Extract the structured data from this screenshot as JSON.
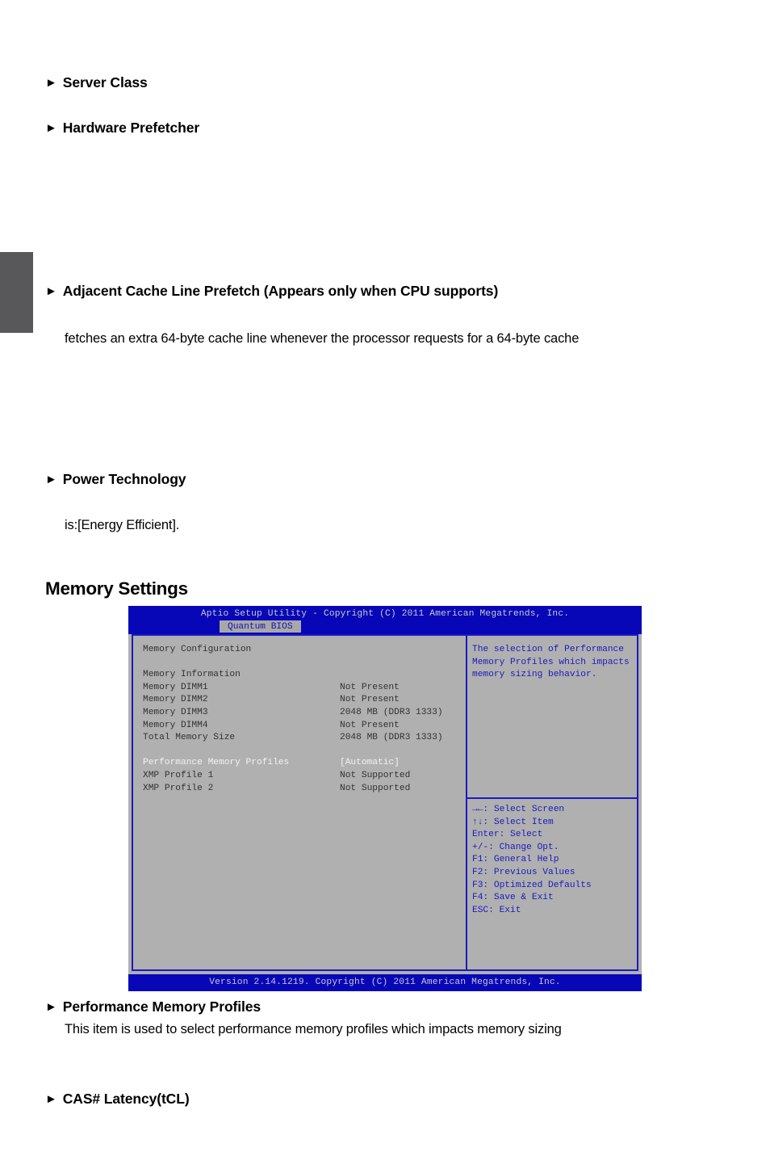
{
  "page": {
    "edge_tab": "section-tab-marker"
  },
  "doc": {
    "items": [
      {
        "name": "server-class",
        "marker": "►",
        "label": "Server Class"
      },
      {
        "name": "hardware-prefetcher",
        "marker": "►",
        "label": "Hardware Prefetcher"
      },
      {
        "name": "adjacent-cache-line-prefetch",
        "marker": "►",
        "label": "Adjacent Cache Line Prefetch (Appears only when CPU supports)"
      },
      {
        "name": "power-technology",
        "marker": "►",
        "label": "Power Technology"
      },
      {
        "name": "performance-memory-profiles",
        "marker": "►",
        "label": "Performance Memory Profiles"
      },
      {
        "name": "cas-latency-tcl",
        "marker": "►",
        "label": "CAS# Latency(tCL)"
      }
    ],
    "body": {
      "adjacent_cache_desc": "fetches an extra 64-byte cache line whenever the processor requests for a 64-byte cache",
      "power_technology_desc": "is:[Energy Efficient].",
      "performance_memory_profiles_desc": "This item is used to select performance memory profiles which impacts memory sizing"
    },
    "section_title": "Memory Settings"
  },
  "bios": {
    "title": "Aptio Setup Utility - Copyright (C) 2011 American Megatrends, Inc.",
    "tab": "Quantum BIOS",
    "footer": "Version 2.14.1219. Copyright (C) 2011 American Megatrends, Inc.",
    "left_rows": [
      {
        "label": "Memory Configuration",
        "value": "",
        "selected": false
      },
      {
        "label": "",
        "value": "",
        "selected": false
      },
      {
        "label": "Memory Information",
        "value": "",
        "selected": false
      },
      {
        "label": "Memory DIMM1",
        "value": "Not Present",
        "selected": false
      },
      {
        "label": "Memory DIMM2",
        "value": "Not Present",
        "selected": false
      },
      {
        "label": "Memory DIMM3",
        "value": "2048 MB (DDR3 1333)",
        "selected": false
      },
      {
        "label": "Memory DIMM4",
        "value": "Not Present",
        "selected": false
      },
      {
        "label": "Total Memory Size",
        "value": "2048 MB (DDR3 1333)",
        "selected": false
      },
      {
        "label": "",
        "value": "",
        "selected": false
      },
      {
        "label": "Performance Memory Profiles",
        "value": "[Automatic]",
        "selected": true
      },
      {
        "label": "XMP Profile 1",
        "value": "Not Supported",
        "selected": false
      },
      {
        "label": "XMP Profile 2",
        "value": "Not Supported",
        "selected": false
      }
    ],
    "help": "The selection of Performance\nMemory Profiles which impacts\nmemory sizing behavior.",
    "keys": [
      "→←: Select Screen",
      "↑↓: Select Item",
      "Enter: Select",
      "+/-: Change Opt.",
      "F1: General Help",
      "F2: Previous Values",
      "F3: Optimized Defaults",
      "F4: Save & Exit",
      "ESC: Exit"
    ]
  },
  "colors": {
    "bios_blue": "#0707b8",
    "bios_border_blue": "#1a1ac0",
    "bios_gray": "#b0b0b0",
    "tab_gray": "#58585a"
  }
}
